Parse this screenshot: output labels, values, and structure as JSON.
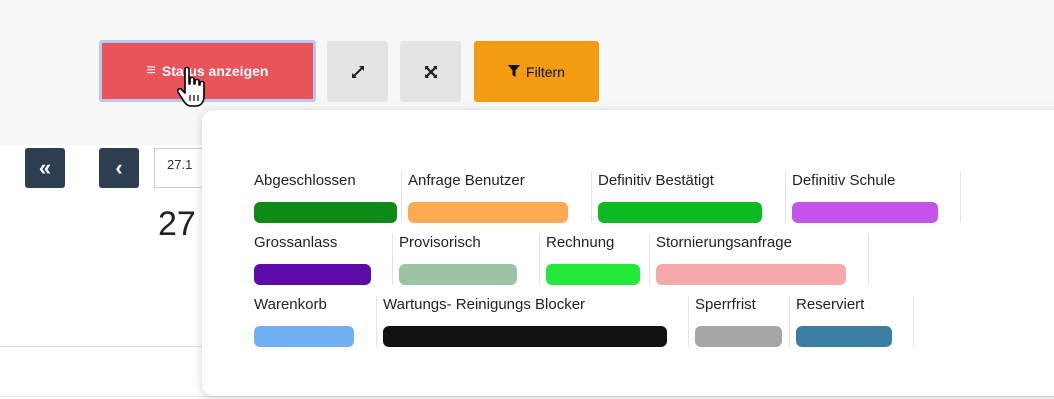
{
  "toolbar": {
    "status_label": "Status anzeigen",
    "filter_label": "Filtern"
  },
  "nav": {
    "first_label": "«",
    "prev_label": "‹",
    "date_input_value": "27.1",
    "date_heading": "27"
  },
  "legend": {
    "rows": [
      [
        {
          "label": "Abgeschlossen",
          "color": "#0f8a16"
        },
        {
          "label": "Anfrage Benutzer",
          "color": "#fdab52"
        },
        {
          "label": "Definitiv Bestätigt",
          "color": "#0dba21"
        },
        {
          "label": "Definitiv Schule",
          "color": "#c453ee"
        }
      ],
      [
        {
          "label": "Grossanlass",
          "color": "#5c0aa8"
        },
        {
          "label": "Provisorisch",
          "color": "#9dc2a4"
        },
        {
          "label": "Rechnung",
          "color": "#22e83a"
        },
        {
          "label": "Stornierungsanfrage",
          "color": "#f7a8aa"
        }
      ],
      [
        {
          "label": "Warenkorb",
          "color": "#72b0f4"
        },
        {
          "label": "Wartungs- Reinigungs Blocker",
          "color": "#111111"
        },
        {
          "label": "Sperrfrist",
          "color": "#a6a6a6"
        },
        {
          "label": "Reserviert",
          "color": "#3a7fa3"
        }
      ]
    ]
  },
  "colors": {
    "status_button": "#e9545a",
    "filter_button": "#f39c12",
    "nav_button": "#2c3e50"
  }
}
